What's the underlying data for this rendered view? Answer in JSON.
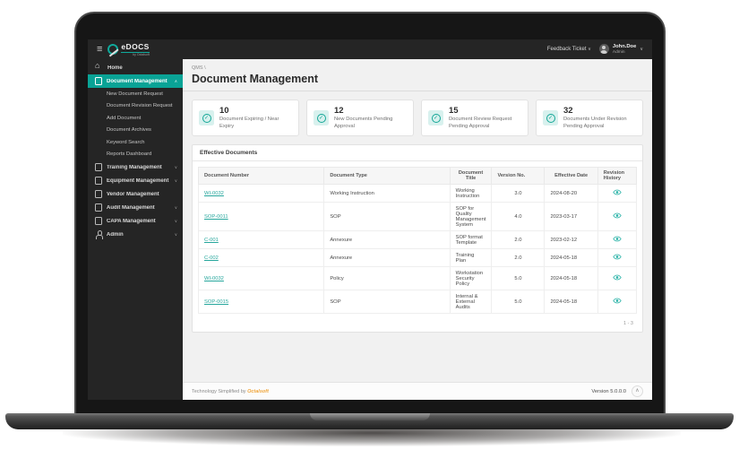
{
  "colors": {
    "accent": "#0aa396",
    "accent_light": "#d8f1ee",
    "link": "#27a79d",
    "brand_orange": "#f0a63c",
    "dark": "#252525"
  },
  "topbar": {
    "logo_text": "eDOCS",
    "logo_sub": "by Octalsoft",
    "feedback_label": "Feedback Ticket",
    "feedback_chevron": "∨",
    "user_name": "John.Doe",
    "user_role": "Admin",
    "user_chevron": "∨"
  },
  "sidebar": {
    "top_items": [
      {
        "label": "Home",
        "icon": "home-icon",
        "chevron": "",
        "active": false
      },
      {
        "label": "Document Management",
        "icon": "document-management-icon",
        "chevron": "∧",
        "active": true
      }
    ],
    "submenu": [
      "New Document Request",
      "Document Revision Request",
      "Add Document",
      "Document Archives",
      "Keyword Search",
      "Reports Dashboard"
    ],
    "bottom_items": [
      {
        "label": "Training Management",
        "icon": "training-icon",
        "chevron": "∨",
        "active": false
      },
      {
        "label": "Equipment Management",
        "icon": "equipment-icon",
        "chevron": "∨",
        "active": false
      },
      {
        "label": "Vendor Management",
        "icon": "vendor-icon",
        "chevron": "",
        "active": false
      },
      {
        "label": "Audit Management",
        "icon": "audit-icon",
        "chevron": "∨",
        "active": false
      },
      {
        "label": "CAPA Management",
        "icon": "capa-icon",
        "chevron": "∨",
        "active": false
      },
      {
        "label": "Admin",
        "icon": "admin-icon",
        "chevron": "∨",
        "active": false
      }
    ]
  },
  "header": {
    "breadcrumb": "QMS",
    "breadcrumb_sep": "\\",
    "title": "Document Management"
  },
  "cards": [
    {
      "value": "10",
      "label": "Document Expiring / Near Expiry",
      "icon": "check-circle-icon"
    },
    {
      "value": "12",
      "label": "New Documents Pending Approval",
      "icon": "check-circle-icon"
    },
    {
      "value": "15",
      "label": "Document Review Request Pending Approval",
      "icon": "check-circle-icon"
    },
    {
      "value": "32",
      "label": "Documents Under Revision Pending Approval",
      "icon": "check-circle-icon"
    }
  ],
  "table": {
    "title": "Effective Documents",
    "columns": [
      "Document Number",
      "Document Type",
      "Document Title",
      "Version No.",
      "Effective Date",
      "Revision History"
    ],
    "rows": [
      {
        "number": "WI-0032",
        "type": "Working Instruction",
        "title": "Working Instruction",
        "version": "3.0",
        "date": "2024-08-20"
      },
      {
        "number": "SOP-0011",
        "type": "SOP",
        "title": "SOP for Quality Management System",
        "version": "4.0",
        "date": "2023-03-17"
      },
      {
        "number": "C-001",
        "type": "Annexure",
        "title": "SOP format Template",
        "version": "2.0",
        "date": "2023-02-12"
      },
      {
        "number": "C-002",
        "type": "Annexure",
        "title": "Training Plan",
        "version": "2.0",
        "date": "2024-05-18"
      },
      {
        "number": "WI-0032",
        "type": "Policy",
        "title": "Workstation Security Policy",
        "version": "5.0",
        "date": "2024-05-18"
      },
      {
        "number": "SOP-0015",
        "type": "SOP",
        "title": "Internal & External Audits",
        "version": "5.0",
        "date": "2024-05-18"
      }
    ],
    "pagination": "1 - 3"
  },
  "footer": {
    "left_prefix": "Technology Simplified by ",
    "brand": "Octalsoft",
    "version": "Version 5.0.0.0",
    "scrolltop_chevron": "∧"
  }
}
